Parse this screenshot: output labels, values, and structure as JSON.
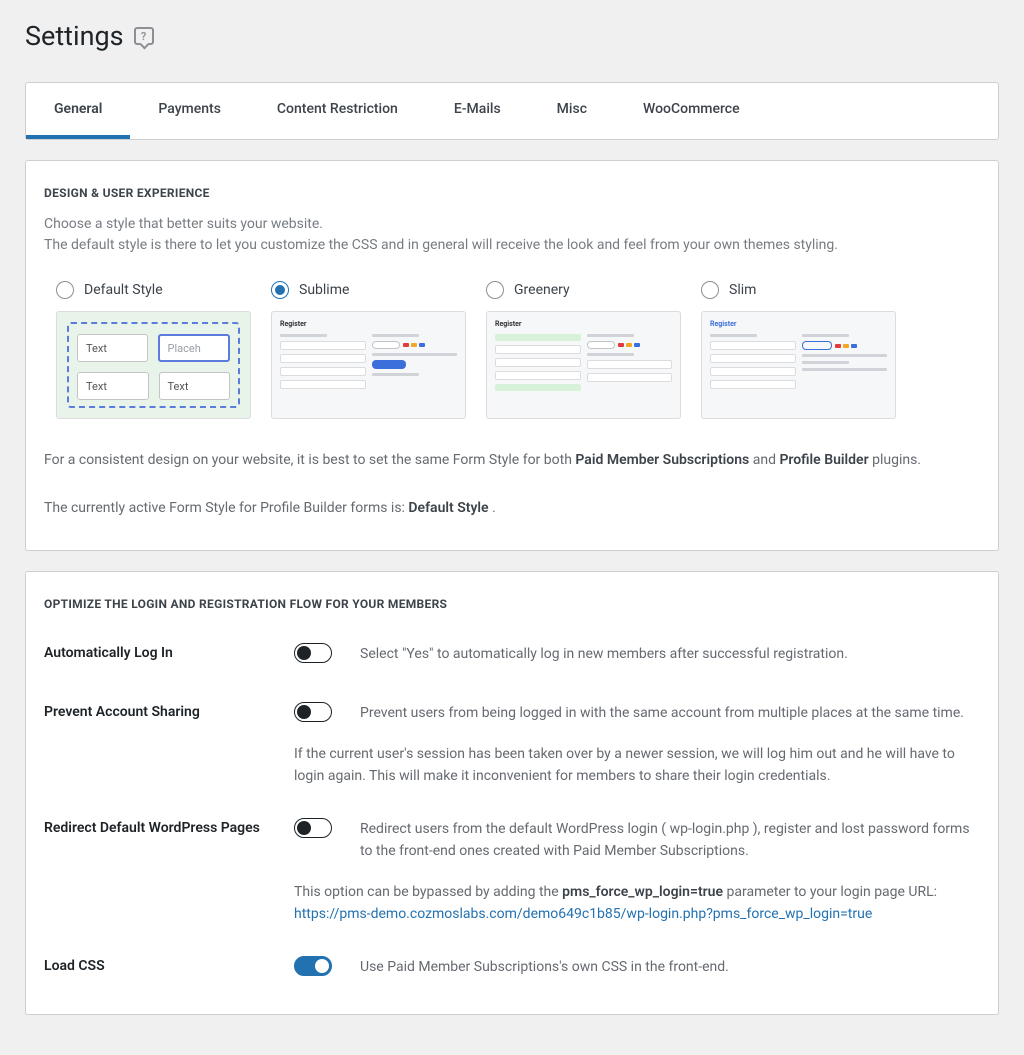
{
  "page": {
    "title": "Settings"
  },
  "tabs": [
    {
      "label": "General",
      "active": true
    },
    {
      "label": "Payments",
      "active": false
    },
    {
      "label": "Content Restriction",
      "active": false
    },
    {
      "label": "E-Mails",
      "active": false
    },
    {
      "label": "Misc",
      "active": false
    },
    {
      "label": "WooCommerce",
      "active": false
    }
  ],
  "design": {
    "heading": "DESIGN & USER EXPERIENCE",
    "desc_line1": "Choose a style that better suits your website.",
    "desc_line2": "The default style is there to let you customize the CSS and in general will receive the look and feel from your own themes styling.",
    "options": [
      {
        "label": "Default Style",
        "selected": false
      },
      {
        "label": "Sublime",
        "selected": true
      },
      {
        "label": "Greenery",
        "selected": false
      },
      {
        "label": "Slim",
        "selected": false
      }
    ],
    "preview_default": {
      "text": "Text",
      "placeholder": "Placeh"
    },
    "preview_register_title": "Register",
    "foot_line1_a": "For a consistent design on your website, it is best to set the same Form Style for both ",
    "foot_line1_b": "Paid Member Subscriptions",
    "foot_line1_c": " and ",
    "foot_line1_d": "Profile Builder",
    "foot_line1_e": " plugins.",
    "foot_line2_a": "The currently active Form Style for Profile Builder forms is: ",
    "foot_line2_b": "Default Style ",
    "foot_line2_c": "."
  },
  "optimize": {
    "heading": "OPTIMIZE THE LOGIN AND REGISTRATION FLOW FOR YOUR MEMBERS",
    "auto_login": {
      "label": "Automatically Log In",
      "desc": "Select \"Yes\" to automatically log in new members after successful registration.",
      "value": false
    },
    "prevent_sharing": {
      "label": "Prevent Account Sharing",
      "desc": "Prevent users from being logged in with the same account from multiple places at the same time.",
      "sub": "If the current user's session has been taken over by a newer session, we will log him out and he will have to login again. This will make it inconvenient for members to share their login credentials.",
      "value": false
    },
    "redirect_default": {
      "label": "Redirect Default WordPress Pages",
      "desc": "Redirect users from the default WordPress login ( wp-login.php ), register and lost password forms to the front-end ones created with Paid Member Subscriptions.",
      "sub_a": "This option can be bypassed by adding the ",
      "sub_b": "pms_force_wp_login=true",
      "sub_c": " parameter to your login page URL: ",
      "sub_link": "https://pms-demo.cozmoslabs.com/demo649c1b85/wp-login.php?pms_force_wp_login=true",
      "value": false
    },
    "load_css": {
      "label": "Load CSS",
      "desc": "Use Paid Member Subscriptions's own CSS in the front-end.",
      "value": true
    }
  }
}
